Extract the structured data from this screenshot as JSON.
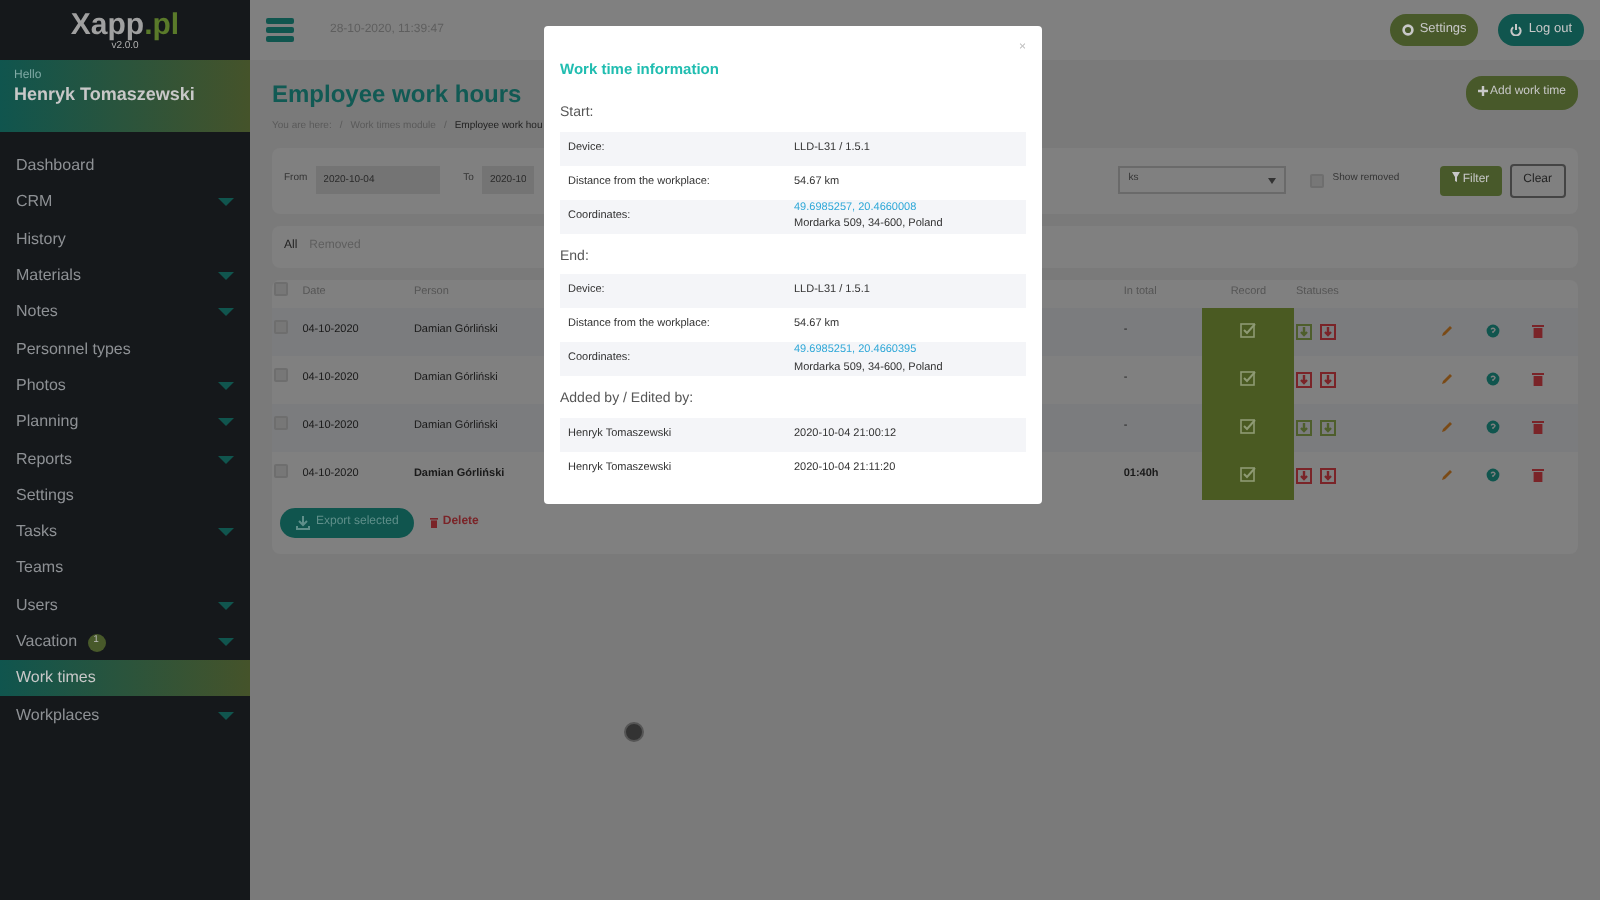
{
  "sidebar": {
    "logo": {
      "name": "Xapp",
      "suffix": ".pl",
      "version": "v2.0.0"
    },
    "greeting": "Hello",
    "user": "Henryk Tomaszewski",
    "items": [
      {
        "label": "Dashboard",
        "expandable": false,
        "selected": false
      },
      {
        "label": "CRM",
        "expandable": true,
        "selected": false
      },
      {
        "label": "History",
        "expandable": false,
        "selected": false
      },
      {
        "label": "Materials",
        "expandable": true,
        "selected": false
      },
      {
        "label": "Notes",
        "expandable": true,
        "selected": false
      },
      {
        "label": "Personnel types",
        "expandable": false,
        "selected": false
      },
      {
        "label": "Photos",
        "expandable": true,
        "selected": false
      },
      {
        "label": "Planning",
        "expandable": true,
        "selected": false
      },
      {
        "label": "Reports",
        "expandable": true,
        "selected": false
      },
      {
        "label": "Settings",
        "expandable": false,
        "selected": false
      },
      {
        "label": "Tasks",
        "expandable": true,
        "selected": false
      },
      {
        "label": "Teams",
        "expandable": false,
        "selected": false
      },
      {
        "label": "Users",
        "expandable": true,
        "selected": false
      },
      {
        "label": "Vacation",
        "expandable": true,
        "selected": false,
        "badge": "1"
      },
      {
        "label": "Work times",
        "expandable": false,
        "selected": true
      },
      {
        "label": "Workplaces",
        "expandable": true,
        "selected": false
      }
    ]
  },
  "topbar": {
    "datetime": "28-10-2020, 11:39:47",
    "buttons": [
      {
        "label": "Settings",
        "kind": "settings"
      },
      {
        "label": "Log out",
        "kind": "logout"
      }
    ]
  },
  "page": {
    "title": "Employee work hours",
    "breadcrumb": [
      {
        "text": "You are here:"
      },
      {
        "separator": "/",
        "text": "Work times module"
      },
      {
        "separator": "/",
        "text": "Employee work hou"
      }
    ],
    "add_button": "Add work time",
    "filter": {
      "from_label": "From",
      "from_value": "2020-10-04",
      "to_label": "To",
      "to_value": "2020-10",
      "select_value": "ks",
      "show_removed": {
        "label": "Show removed",
        "checked": false
      },
      "filter_button": "Filter",
      "clear_button": "Clear"
    },
    "tabs": [
      {
        "label": "All",
        "selected": true
      },
      {
        "label": "Removed",
        "selected": false
      }
    ],
    "table": {
      "columns": [
        "Date",
        "Person",
        "In total",
        "Record",
        "Statuses"
      ],
      "select_all_checked": false,
      "rows": [
        {
          "checked": false,
          "date": "04-10-2020",
          "person": "Damian Górliński",
          "total": "-",
          "bold": false,
          "record_checked": true,
          "statuses": [
            {
              "color": "#4e5e2c"
            },
            {
              "color": "#7a2428"
            }
          ]
        },
        {
          "checked": false,
          "date": "04-10-2020",
          "person": "Damian Górliński",
          "total": "-",
          "bold": false,
          "record_checked": true,
          "statuses": [
            {
              "color": "#7a2428"
            },
            {
              "color": "#7a2428"
            }
          ]
        },
        {
          "checked": false,
          "date": "04-10-2020",
          "person": "Damian Górliński",
          "total": "-",
          "bold": false,
          "record_checked": true,
          "statuses": [
            {
              "color": "#4e5e2c"
            },
            {
              "color": "#4e5e2c"
            }
          ]
        },
        {
          "checked": false,
          "date": "04-10-2020",
          "person": "Damian Górliński",
          "total": "01:40h",
          "bold": true,
          "record_checked": true,
          "statuses": [
            {
              "color": "#7a2428"
            },
            {
              "color": "#7a2428"
            }
          ]
        }
      ]
    },
    "footer": {
      "export_button": "Export selected",
      "delete_button": "Delete"
    }
  },
  "modal": {
    "title": "Work time information",
    "close": "×",
    "sections": [
      {
        "heading": "Start:",
        "rows": [
          {
            "label": "Device:",
            "value": "LLD-L31 / 1.5.1"
          },
          {
            "label": "Distance from the workplace:",
            "value": "54.67 km"
          },
          {
            "label": "Coordinates:",
            "link": "49.6985257, 20.4660008",
            "value": "Mordarka 509, 34-600, Poland"
          }
        ]
      },
      {
        "heading": "End:",
        "rows": [
          {
            "label": "Device:",
            "value": "LLD-L31 / 1.5.1"
          },
          {
            "label": "Distance from the workplace:",
            "value": "54.67 km"
          },
          {
            "label": "Coordinates:",
            "link": "49.6985251, 20.4660395",
            "value": "Mordarka 509, 34-600, Poland"
          }
        ]
      },
      {
        "heading": "Added by / Edited by:",
        "rows": [
          {
            "label": "Henryk Tomaszewski",
            "value": "2020-10-04 21:00:12"
          },
          {
            "label": "Henryk Tomaszewski",
            "value": "2020-10-04 21:11:20"
          }
        ]
      }
    ]
  }
}
